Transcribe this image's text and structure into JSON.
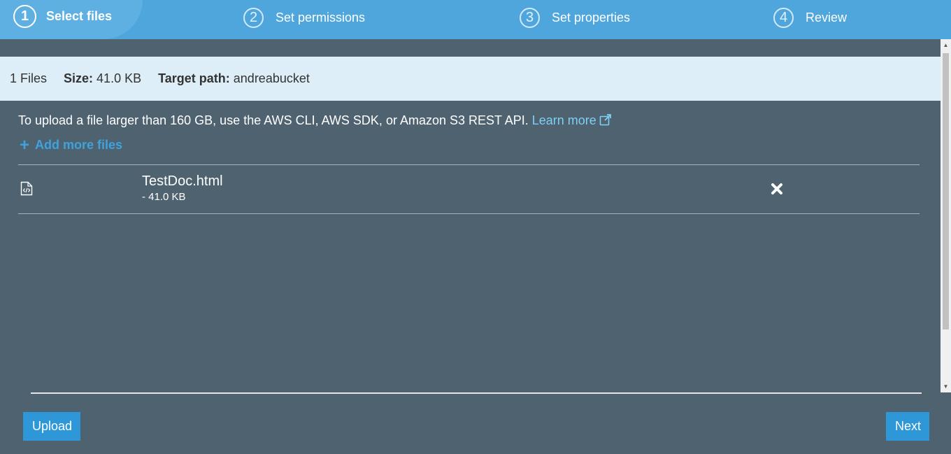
{
  "stepper": {
    "steps": [
      {
        "number": "1",
        "label": "Select files",
        "active": true
      },
      {
        "number": "2",
        "label": "Set permissions",
        "active": false
      },
      {
        "number": "3",
        "label": "Set properties",
        "active": false
      },
      {
        "number": "4",
        "label": "Review",
        "active": false
      }
    ]
  },
  "summary": {
    "files": "1 Files",
    "size_label": "Size:",
    "size_value": "41.0 KB",
    "target_label": "Target path:",
    "target_value": "andreabucket"
  },
  "notice": {
    "text": "To upload a file larger than 160 GB, use the AWS CLI, AWS SDK, or Amazon S3 REST API.",
    "link": "Learn more"
  },
  "add_more_label": "Add more files",
  "files": [
    {
      "name": "TestDoc.html",
      "size": "- 41.0 KB",
      "icon": "html-file-icon"
    }
  ],
  "buttons": {
    "upload": "Upload",
    "next": "Next"
  },
  "colors": {
    "header": "#4ea6dd",
    "background": "#4e6270",
    "info_band": "#ddeef8",
    "primary_button": "#2e97d8",
    "link": "#7fd0f5"
  }
}
